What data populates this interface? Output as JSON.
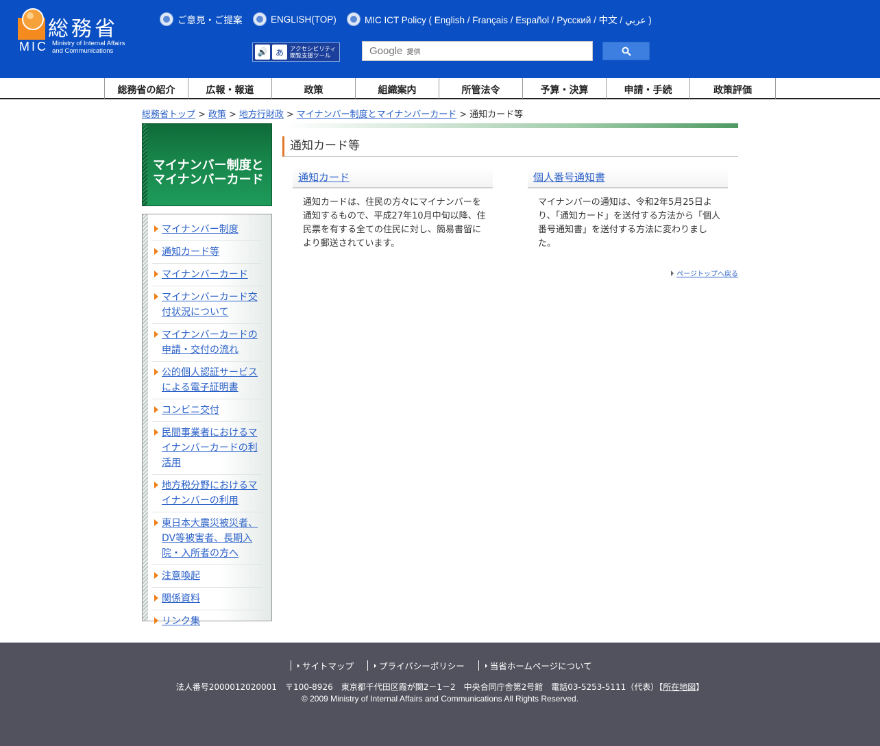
{
  "header": {
    "logo": {
      "kanji": "総務省",
      "abbr": "MIC",
      "en_line1": "Ministry of Internal Affairs",
      "en_line2": "and Communications"
    },
    "top_links": [
      {
        "label": "ご意見・ご提案"
      },
      {
        "label": "ENGLISH(TOP)"
      },
      {
        "label": "MIC ICT Policy ( English / Français / Español / Русский / 中文 / عربي )"
      }
    ],
    "access_tool": {
      "line1": "アクセシビリティ",
      "line2": "閲覧支援ツール"
    },
    "search": {
      "brand": "Google",
      "provided": "提供"
    }
  },
  "gnav": {
    "items": [
      "総務省の紹介",
      "広報・報道",
      "政策",
      "組織案内",
      "所管法令",
      "予算・決算",
      "申請・手続",
      "政策評価"
    ]
  },
  "breadcrumb": {
    "items": [
      "総務省トップ",
      "政策",
      "地方行財政",
      "マイナンバー制度とマイナンバーカード"
    ],
    "current": "通知カード等",
    "separator": ">"
  },
  "sidebar": {
    "title": "マイナンバー制度とマイナンバーカード",
    "items": [
      "マイナンバー制度",
      "通知カード等",
      "マイナンバーカード",
      "マイナンバーカード交付状況について",
      "マイナンバーカードの申請・交付の流れ",
      "公的個人認証サービスによる電子証明書",
      "コンビニ交付",
      "民間事業者におけるマイナンバーカードの利活用",
      "地方税分野におけるマイナンバーの利用",
      "東日本大震災被災者、DV等被害者、長期入院・入所者の方へ",
      "注意喚起",
      "関係資料",
      "リンク集"
    ]
  },
  "main": {
    "heading": "通知カード等",
    "cards": [
      {
        "title": "通知カード",
        "body": "通知カードは、住民の方々にマイナンバーを通知するもので、平成27年10月中旬以降、住民票を有する全ての住民に対し、簡易書留により郵送されています。"
      },
      {
        "title": "個人番号通知書",
        "body": "マイナンバーの通知は、令和2年5月25日より、「通知カード」を送付する方法から「個人番号通知書」を送付する方法に変わりました。"
      }
    ],
    "page_top": "ページトップへ戻る"
  },
  "footer": {
    "links": [
      "サイトマップ",
      "プライバシーポリシー",
      "当省ホームページについて"
    ],
    "address": "法人番号2000012020001　〒100-8926　東京都千代田区霞が関2－1－2　中央合同庁舎第2号館　電話03-5253-5111（代表）",
    "map_link": "所在地図",
    "copyright": "© 2009 Ministry of Internal Affairs and Communications All Rights Reserved."
  },
  "colors": {
    "header_bg": "#0a4fc3",
    "sidebar_title_bg": "#178348",
    "accent_orange": "#f07f1a",
    "footer_bg": "#52525e",
    "link": "#2a60c8"
  }
}
